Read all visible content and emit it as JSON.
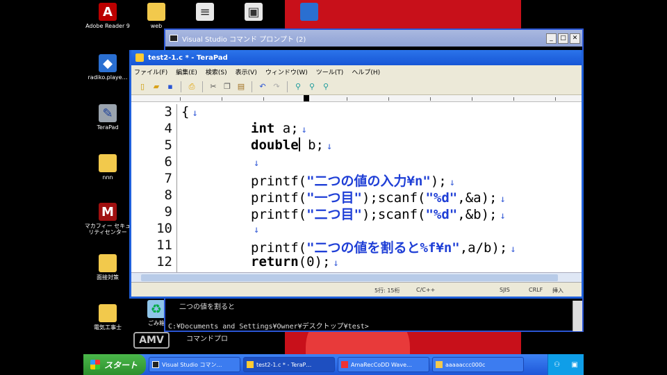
{
  "desktop": {
    "icons": [
      {
        "label": "Adobe Reader 9",
        "symbol": "A"
      },
      {
        "label": "web",
        "symbol": "▬"
      },
      {
        "label": "",
        "symbol": "≡"
      },
      {
        "label": "",
        "symbol": "▣"
      },
      {
        "label": "radiko.playe…",
        "symbol": "◆"
      },
      {
        "label": "TeraPad",
        "symbol": "✎"
      },
      {
        "label": "nnn",
        "symbol": "▬"
      },
      {
        "label": "マカフィー セキュリティセンター",
        "symbol": "M"
      },
      {
        "label": "面接対策",
        "symbol": "▬"
      },
      {
        "label": "電気工事士",
        "symbol": "▬"
      },
      {
        "label": "ごみ箱",
        "symbol": "♻"
      }
    ]
  },
  "console": {
    "title": "Visual Studio コマンド プロンプト (2)",
    "line1": "二つの値を割ると",
    "line2": "C:¥Documents and Settings¥Owner¥デスクトップ¥test>",
    "line3": "コマンドプロ"
  },
  "terapad": {
    "title": "test2-1.c * - TeraPad",
    "menu": [
      "ファイル(F)",
      "編集(E)",
      "検索(S)",
      "表示(V)",
      "ウィンドウ(W)",
      "ツール(T)",
      "ヘルプ(H)"
    ],
    "toolbar_icons": [
      "new-icon",
      "open-icon",
      "save-icon",
      "print-icon",
      "cut-icon",
      "copy-icon",
      "paste-icon",
      "undo-icon",
      "redo-icon",
      "find-icon",
      "find-next-icon",
      "find-prev-icon"
    ],
    "eol_mark": "↓",
    "lines": [
      {
        "num": "3",
        "text": "{"
      },
      {
        "num": "4",
        "kw": "int",
        "rest": " a;"
      },
      {
        "num": "5",
        "kw": "double",
        "rest": " b;"
      },
      {
        "num": "6",
        "text": ""
      },
      {
        "num": "7",
        "pre": "printf(",
        "str": "\"二つの値の入力¥n\"",
        "post": ");"
      },
      {
        "num": "8",
        "pre": "printf(",
        "str": "\"一つ目\"",
        "mid": ");scanf(",
        "str2": "\"%d\"",
        "post": ",&a);"
      },
      {
        "num": "9",
        "pre": "printf(",
        "str": "\"二つ目\"",
        "mid": ");scanf(",
        "str2": "\"%d\"",
        "post": ",&b);"
      },
      {
        "num": "10",
        "text": ""
      },
      {
        "num": "11",
        "pre": "printf(",
        "str": "\"二つの値を割ると%f¥n\"",
        "post": ",a/b);"
      },
      {
        "num": "12",
        "kw": "return",
        "rest": "(0);"
      }
    ],
    "status": {
      "position": "5行: 15桁",
      "lang": "C/C++",
      "encoding": "SJIS",
      "eol": "CRLF",
      "mode": "挿入"
    }
  },
  "watermark": "AMV",
  "taskbar": {
    "start_label": "スタート",
    "tasks": [
      "Visual Studio コマン…",
      "test2-1.c * - TeraP…",
      "AmaRecCoDD Wave…",
      "aaaaaccc000c"
    ],
    "tray_icons": [
      "user-icon",
      "network-icon"
    ]
  }
}
